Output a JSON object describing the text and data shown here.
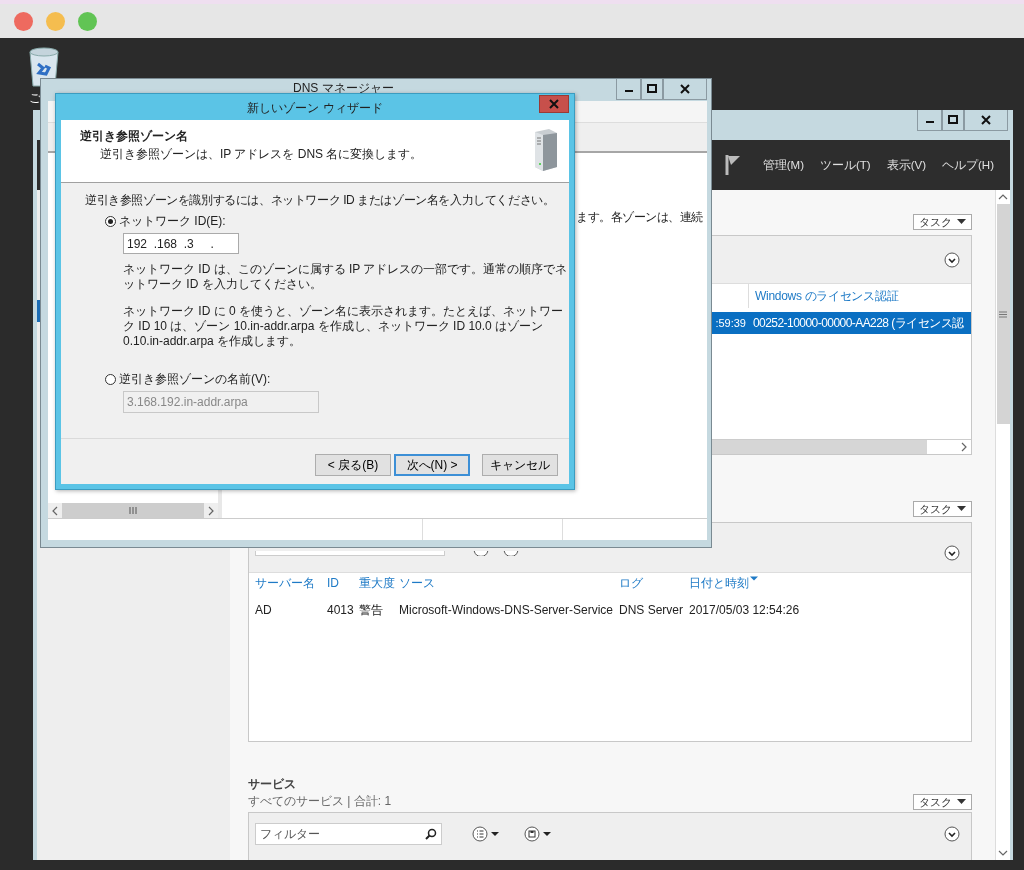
{
  "desktop": {
    "icons": [
      {
        "label": "ご"
      }
    ]
  },
  "server_manager": {
    "menu": [
      "管理(M)",
      "ツール(T)",
      "表示(V)",
      "ヘルプ(H)"
    ],
    "license_panel": {
      "task_label": "タスク",
      "value_heading": "Windows のライセンス認証",
      "rows": [
        {
          "selected": true,
          "cells": [
            ":59:39",
            "00252-10000-00000-AA228 (ライセンス認"
          ]
        }
      ]
    },
    "events_panel": {
      "task_label": "タスク",
      "columns": [
        {
          "label": "サーバー名",
          "sorted": false
        },
        {
          "label": "ID",
          "sorted": false
        },
        {
          "label": "重大度",
          "sorted": false
        },
        {
          "label": "ソース",
          "sorted": false
        },
        {
          "label": "ログ",
          "sorted": false
        },
        {
          "label": "日付と時刻",
          "sorted": true
        }
      ],
      "rows": [
        {
          "selected": false,
          "cells": [
            "AD",
            "4013",
            "警告",
            "Microsoft-Windows-DNS-Server-Service",
            "DNS Server",
            "2017/05/03 12:54:26"
          ]
        }
      ]
    },
    "services": {
      "title": "サービス",
      "subtitle": "すべてのサービス | 合計: 1",
      "task_label": "タスク",
      "filter_placeholder": "フィルター"
    }
  },
  "dns_manager": {
    "title": "DNS マネージャー",
    "pane_text": "ます。各ゾーンは、連続"
  },
  "wizard": {
    "title": "新しいゾーン ウィザード",
    "heading": "逆引き参照ゾーン名",
    "subheading": "逆引き参照ゾーンは、IP アドレスを DNS 名に変換します。",
    "instruction": "逆引き参照ゾーンを識別するには、ネットワーク ID またはゾーン名を入力してください。",
    "options": [
      {
        "kind": "network_id",
        "label": "ネットワーク ID(E):",
        "selected": true,
        "value": "192  .168  .3     .",
        "notes": [
          "ネットワーク ID は、このゾーンに属する IP アドレスの一部です。通常の順序でネットワーク ID を入力してください。",
          "ネットワーク ID に 0 を使うと、ゾーン名に表示されます。たとえば、ネットワーク ID 10 は、ゾーン 10.in-addr.arpa を作成し、ネットワーク ID 10.0 はゾーン 0.10.in-addr.arpa を作成します。"
        ]
      },
      {
        "kind": "zone_name",
        "label": "逆引き参照ゾーンの名前(V):",
        "selected": false,
        "value": "3.168.192.in-addr.arpa"
      }
    ],
    "buttons": [
      {
        "label": "< 戻る(B)",
        "default": false
      },
      {
        "label": "次へ(N) >",
        "default": true
      },
      {
        "label": "キャンセル",
        "default": false
      }
    ]
  }
}
